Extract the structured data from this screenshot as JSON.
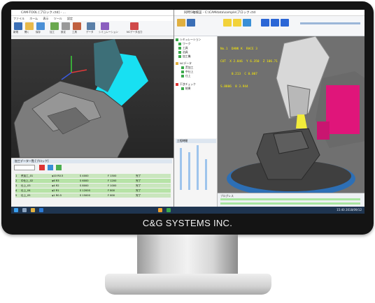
{
  "brand": "C&G SYSTEMS INC.",
  "left_window": {
    "title": "CAM-TOOL [ブロック.ctd] - ...",
    "ribbon_tabs": [
      "ファイル",
      "ホーム",
      "表示",
      "ツール",
      "設定"
    ],
    "ribbon_buttons": [
      "新規",
      "開く",
      "保存",
      "加工",
      "設定",
      "工具",
      "データ",
      "シミュレーション",
      "NCデータ出力"
    ],
    "panel_title": "加工データ一覧 [ブロック]",
    "rows": [
      [
        "1",
        "荒加工_01",
        "φ10 R0.5",
        "S 4000",
        "F 1500",
        "完了"
      ],
      [
        "2",
        "中仕上_02",
        "φ6 R3",
        "S 6000",
        "F 1200",
        "完了"
      ],
      [
        "3",
        "仕上_03",
        "φ4 R2",
        "S 8000",
        "F 1000",
        "完了"
      ],
      [
        "4",
        "仕上_04",
        "φ2 R1",
        "S 12000",
        "F 800",
        "完了"
      ],
      [
        "5",
        "仕上_05",
        "φ1 R0.5",
        "S 15000",
        "F 600",
        "完了"
      ]
    ]
  },
  "right_window": {
    "title": "同時5軸検証 - C:\\CAMdata\\sample\\ブロック.ctd",
    "tree": [
      "シミュレーション",
      "ワーク",
      "工具",
      "治具",
      "加工機",
      "NCデータ",
      "荒加工",
      "中仕上",
      "仕上",
      "干渉チェック",
      "結果"
    ],
    "info_lines": [
      "No.1  DANK K  RACE 3",
      "CUT  X 2.846  Y 6.350  Z 106.71",
      "      0.213  C 0.007",
      "S.8806  8 3.944"
    ],
    "timeline_label": "工程時間",
    "progress_label": "プログレス"
  },
  "taskbar": {
    "time": "15:40",
    "date": "2018/09/12"
  },
  "colors": {
    "accent_green": "#b6e3a6",
    "highlight_cyan": "#00e5ff",
    "tool_yellow": "#f2ec3a",
    "magenta": "#e0157a"
  }
}
